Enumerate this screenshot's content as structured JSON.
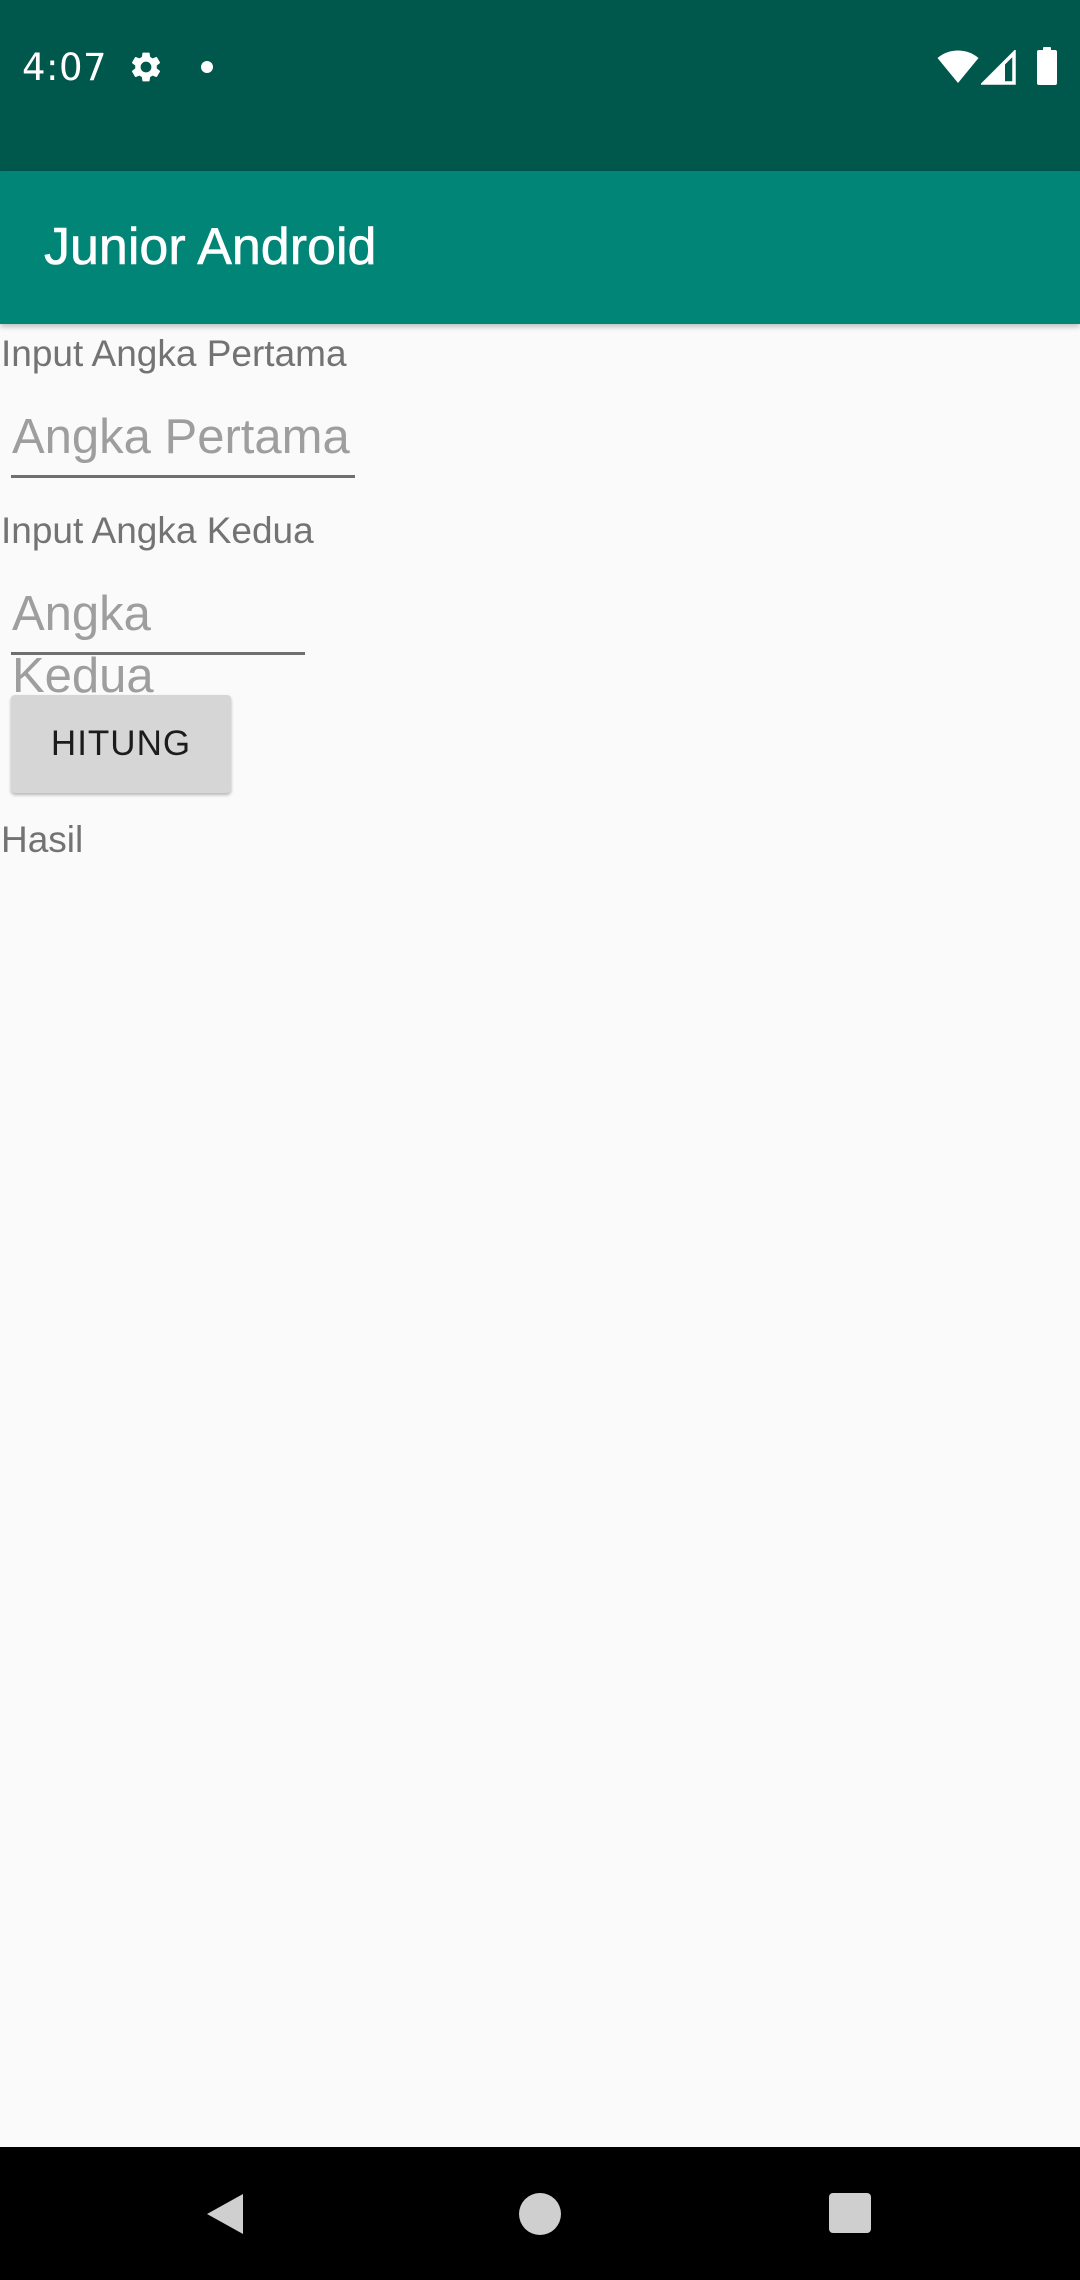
{
  "status_bar": {
    "time": "4:07",
    "icons": [
      "gear-icon",
      "notification-dot-icon",
      "wifi-icon",
      "signal-icon",
      "battery-icon"
    ],
    "background": "#00574b"
  },
  "app_bar": {
    "title": "Junior Android",
    "background": "#008577"
  },
  "form": {
    "first_label": "Input Angka Pertama",
    "first_placeholder": "Angka Pertama",
    "second_label": "Input Angka Kedua",
    "second_placeholder": "Angka Kedua",
    "button_label": "HITUNG",
    "result_label": "Hasil"
  },
  "nav_bar": {
    "icons": [
      "back-icon",
      "home-icon",
      "recents-icon"
    ]
  }
}
